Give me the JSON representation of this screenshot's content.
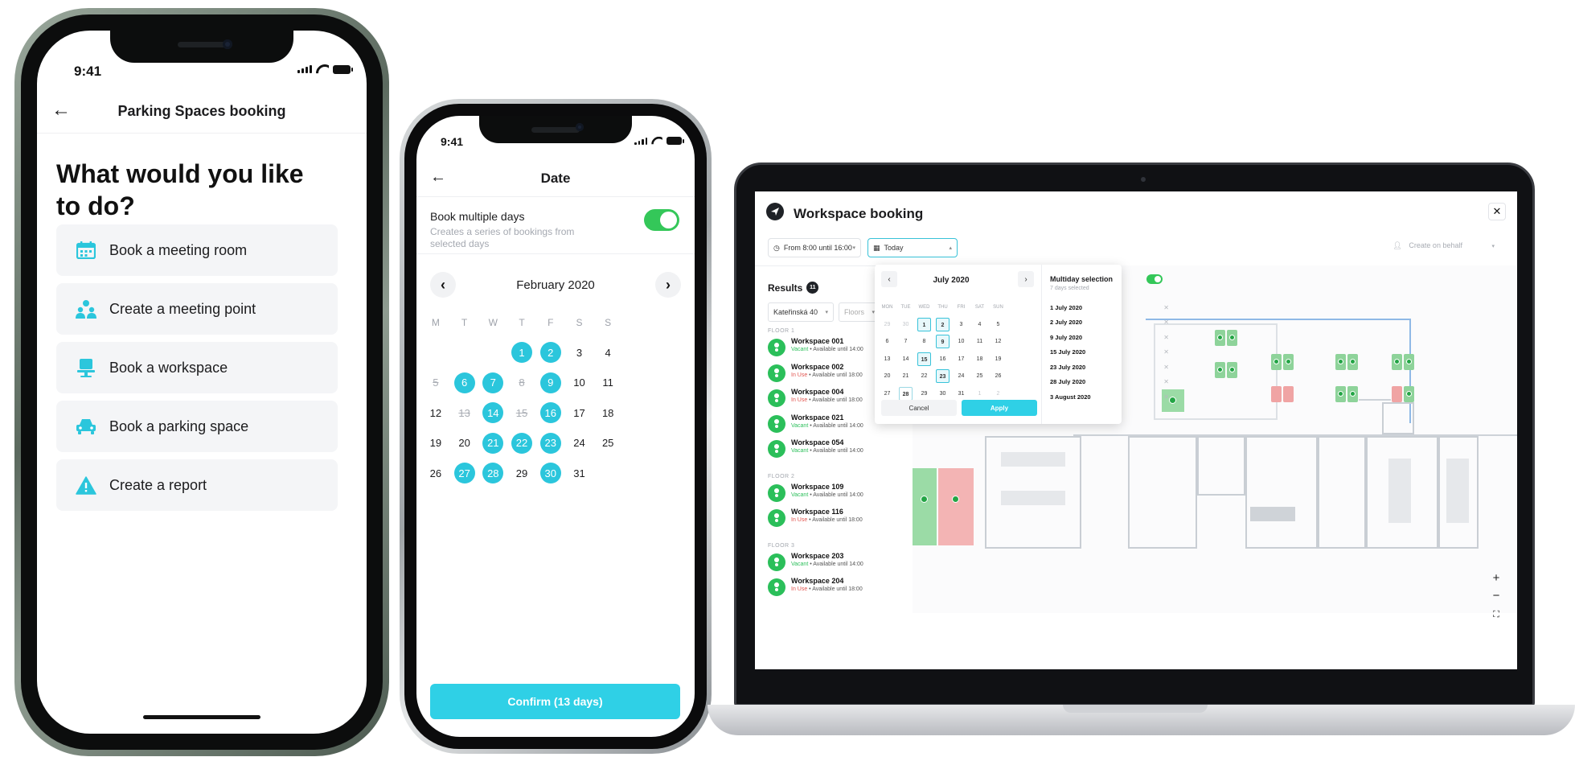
{
  "phone1": {
    "time": "9:41",
    "nav_title": "Parking Spaces booking",
    "heading": "What would you like to do?",
    "menu": [
      {
        "label": "Book a meeting room",
        "icon": "calendar-icon"
      },
      {
        "label": "Create a meeting point",
        "icon": "people-pin-icon"
      },
      {
        "label": "Book a workspace",
        "icon": "desk-chair-icon"
      },
      {
        "label": "Book a parking space",
        "icon": "car-icon"
      },
      {
        "label": "Create a report",
        "icon": "warning-icon"
      }
    ],
    "accent_color": "#2bc6dc"
  },
  "phone2": {
    "time": "9:41",
    "nav_title": "Date",
    "book_multiple_label": "Book multiple days",
    "book_multiple_sub": "Creates a series of bookings from selected days",
    "book_multiple_on": true,
    "month": "February 2020",
    "weekdays": [
      "M",
      "T",
      "W",
      "T",
      "F",
      "S",
      "S"
    ],
    "weeks": [
      [
        "",
        "",
        "",
        "1",
        "2",
        "3",
        "4"
      ],
      [
        "5",
        "6",
        "7",
        "8",
        "9",
        "10",
        "11"
      ],
      [
        "12",
        "13",
        "14",
        "15",
        "16",
        "17",
        "18"
      ],
      [
        "19",
        "20",
        "21",
        "22",
        "23",
        "24",
        "25"
      ],
      [
        "26",
        "27",
        "28",
        "29",
        "30",
        "31",
        ""
      ]
    ],
    "selected_days": [
      "1",
      "2",
      "6",
      "7",
      "9",
      "14",
      "16",
      "21",
      "22",
      "23",
      "27",
      "28",
      "30"
    ],
    "struck_days": [
      "5",
      "8",
      "13",
      "15"
    ],
    "confirm_label": "Confirm (13 days)",
    "accent_color": "#2bc6dc",
    "toggle_color": "#34c759"
  },
  "laptop": {
    "title": "Workspace booking",
    "close": "✕",
    "time_filter": "From 8:00 until 16:00",
    "date_filter": "Today",
    "create_on_behalf": "Create on behalf",
    "results_label": "Results",
    "results_count": "11",
    "building_filter": "Kateřinská 40",
    "floors_filter": "Floors",
    "floors": [
      {
        "label": "FLOOR 1",
        "items": [
          {
            "name": "Workspace 001",
            "state": "Vacant",
            "avail": "• Available until 14:00"
          },
          {
            "name": "Workspace 002",
            "state": "In Use",
            "avail": "• Available until 18:00"
          },
          {
            "name": "Workspace 004",
            "state": "In Use",
            "avail": "• Available until 18:00"
          },
          {
            "name": "Workspace 021",
            "state": "Vacant",
            "avail": "• Available until 14:00"
          },
          {
            "name": "Workspace 054",
            "state": "Vacant",
            "avail": "• Available until 14:00"
          }
        ]
      },
      {
        "label": "FLOOR 2",
        "items": [
          {
            "name": "Workspace 109",
            "state": "Vacant",
            "avail": "• Available until 14:00"
          },
          {
            "name": "Workspace 116",
            "state": "In Use",
            "avail": "• Available until 18:00"
          }
        ]
      },
      {
        "label": "FLOOR 3",
        "items": [
          {
            "name": "Workspace 203",
            "state": "Vacant",
            "avail": "• Available until 14:00"
          },
          {
            "name": "Workspace 204",
            "state": "In Use",
            "avail": "• Available until 18:00"
          }
        ]
      }
    ],
    "picker": {
      "month": "July 2020",
      "weekdays": [
        "MON",
        "TUE",
        "WED",
        "THU",
        "FRI",
        "SAT",
        "SUN"
      ],
      "weeks": [
        [
          "29",
          "30",
          "1",
          "2",
          "3",
          "4",
          "5"
        ],
        [
          "6",
          "7",
          "8",
          "9",
          "10",
          "11",
          "12"
        ],
        [
          "13",
          "14",
          "15",
          "16",
          "17",
          "18",
          "19"
        ],
        [
          "20",
          "21",
          "22",
          "23",
          "24",
          "25",
          "26"
        ],
        [
          "27",
          "28",
          "29",
          "30",
          "31",
          "1",
          "2"
        ]
      ],
      "selected_days": [
        "1",
        "2",
        "9",
        "15",
        "23"
      ],
      "today": "28",
      "cancel_label": "Cancel",
      "apply_label": "Apply",
      "multiday_title": "Multiday selection",
      "multiday_sub": "7 days selected",
      "selected_list": [
        "1 July 2020",
        "2 July 2020",
        "9 July 2020",
        "15 July 2020",
        "23 July 2020",
        "28 July 2020",
        "3 August 2020"
      ]
    },
    "zoom_in": "+",
    "zoom_out": "−",
    "vacant_color": "#2bbf5a",
    "in_use_color": "#e2554f"
  }
}
